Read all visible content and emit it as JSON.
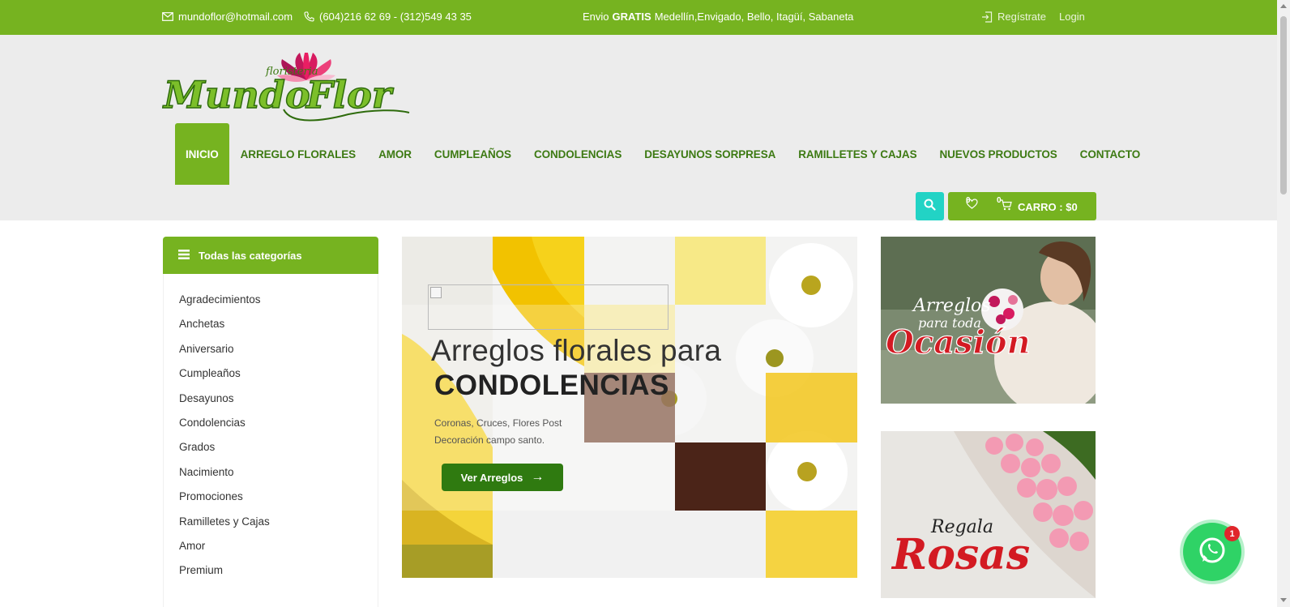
{
  "topbar": {
    "email": "mundoflor@hotmail.com",
    "phone": "(604)216 62 69 - (312)549 43 35",
    "shipping_bold": "GRATIS",
    "shipping_prefix": "Envio",
    "shipping_rest": "Medellín,Envigado, Bello, Itagüí, Sabaneta",
    "register": "Regístrate",
    "login": "Login",
    "icons": {
      "email": "envelope-icon",
      "phone": "phone-icon",
      "register": "sign-in-icon"
    }
  },
  "brand": {
    "logo_small": "floristeria",
    "logo_word1": "Mundo",
    "logo_word2": "Flor"
  },
  "nav": {
    "items": [
      {
        "label": "INICIO"
      },
      {
        "label": "ARREGLO FLORALES"
      },
      {
        "label": "AMOR"
      },
      {
        "label": "CUMPLEAÑOS"
      },
      {
        "label": "CONDOLENCIAS"
      },
      {
        "label": "DESAYUNOS SORPRESA"
      },
      {
        "label": "RAMILLETES Y CAJAS"
      },
      {
        "label": "NUEVOS PRODUCTOS"
      },
      {
        "label": "CONTACTO"
      }
    ],
    "active_index": 0
  },
  "cart": {
    "wishlist_count": "0",
    "cart_count": "0",
    "label": "CARRO : $0"
  },
  "sidebar": {
    "title": "Todas las categorías",
    "categories": [
      "Agradecimientos",
      "Anchetas",
      "Aniversario",
      "Cumpleaños",
      "Desayunos",
      "Condolencias",
      "Grados",
      "Nacimiento",
      "Promociones",
      "Ramilletes y Cajas",
      "Amor",
      "Premium"
    ]
  },
  "slider": {
    "title": "Arreglos florales para",
    "subtitle": "CONDOLENCIAS",
    "desc_line1": "Coronas, Cruces, Flores Post",
    "desc_line2": "Decoración campo santo.",
    "button": "Ver Arreglos",
    "button_arrow": "→"
  },
  "banners": {
    "one": {
      "line1": "Arreglos",
      "line2": "para toda",
      "line3": "Ocasión"
    },
    "two": {
      "line1": "Regala",
      "line2": "Rosas"
    }
  },
  "whatsapp": {
    "badge": "1"
  },
  "colors": {
    "brand_green": "#76b320",
    "dark_green": "#3d7a13",
    "teal": "#22d3c5",
    "whatsapp": "#2fd366"
  }
}
